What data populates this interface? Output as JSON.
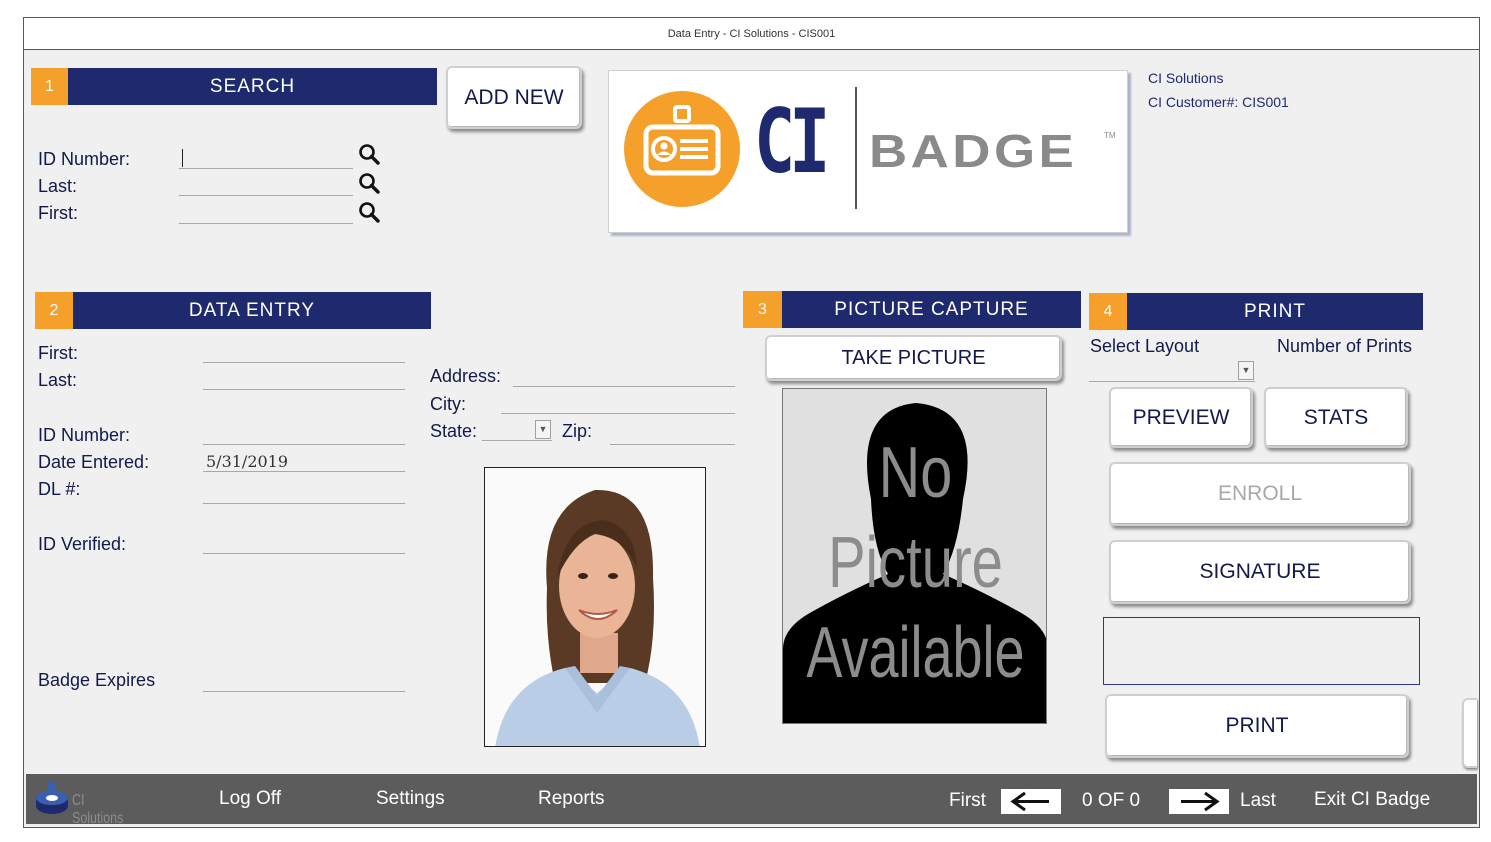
{
  "window": {
    "title": "Data Entry - CI Solutions - CIS001"
  },
  "company": {
    "name": "CI Solutions",
    "customer": "CI Customer#: CIS001"
  },
  "logo": {
    "left_text": "CI",
    "right_text": "BADGE",
    "tm": "TM",
    "footer_text": "CI Solutions"
  },
  "search": {
    "num": "1",
    "title": "SEARCH",
    "id_label": "ID Number:",
    "last_label": "Last:",
    "first_label": "First:"
  },
  "add_new_label": "ADD NEW",
  "data_entry": {
    "num": "2",
    "title": "DATA ENTRY",
    "first_label": "First:",
    "last_label": "Last:",
    "id_label": "ID Number:",
    "date_label": "Date Entered:",
    "date_value": "5/31/2019",
    "dl_label": "DL #:",
    "id_verified_label": "ID Verified:",
    "badge_expires_label": "Badge Expires",
    "address_label": "Address:",
    "city_label": "City:",
    "state_label": "State:",
    "zip_label": "Zip:"
  },
  "picture": {
    "num": "3",
    "title": "PICTURE CAPTURE",
    "take_label": "TAKE PICTURE",
    "placeholder_line1": "No",
    "placeholder_line2": "Picture",
    "placeholder_line3": "Available"
  },
  "print": {
    "num": "4",
    "title": "PRINT",
    "layout_label": "Select Layout",
    "count_label": "Number of Prints",
    "preview_label": "PREVIEW",
    "stats_label": "STATS",
    "enroll_label": "ENROLL",
    "signature_label": "SIGNATURE",
    "print_label": "PRINT"
  },
  "footer": {
    "logoff": "Log Off",
    "settings": "Settings",
    "reports": "Reports",
    "first": "First",
    "record_count": "0  OF  0",
    "last": "Last",
    "exit": "Exit CI Badge"
  },
  "colors": {
    "accent_orange": "#f5a02a",
    "navy": "#1f2a6e",
    "footer_gray": "#5c5c5c",
    "frame_red": "#b03040"
  }
}
